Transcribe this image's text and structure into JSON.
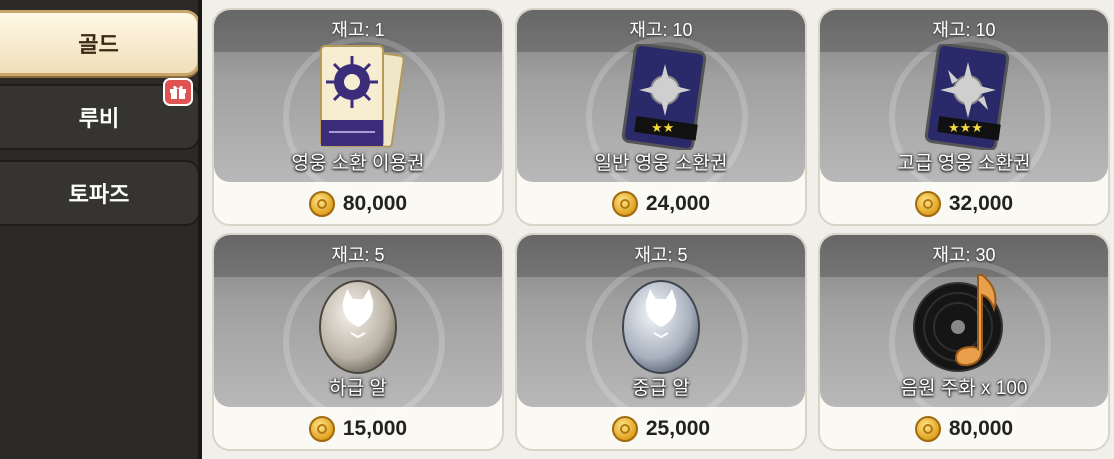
{
  "sidebar": {
    "tabs": [
      {
        "label": "골드"
      },
      {
        "label": "루비"
      },
      {
        "label": "토파즈"
      }
    ]
  },
  "shop": {
    "items": [
      {
        "stock": "재고: 1",
        "name": "영웅 소환 이용권",
        "price": "80,000",
        "icon": "hero-ticket-icon"
      },
      {
        "stock": "재고: 10",
        "name": "일반 영웅 소환권",
        "price": "24,000",
        "icon": "normal-summon-card-icon"
      },
      {
        "stock": "재고: 10",
        "name": "고급 영웅 소환권",
        "price": "32,000",
        "icon": "advanced-summon-card-icon"
      },
      {
        "stock": "재고: 5",
        "name": "하급 알",
        "price": "15,000",
        "icon": "low-egg-icon"
      },
      {
        "stock": "재고: 5",
        "name": "중급 알",
        "price": "25,000",
        "icon": "mid-egg-icon"
      },
      {
        "stock": "재고: 30",
        "name": "음원 주화 x 100",
        "price": "80,000",
        "icon": "music-coin-icon"
      }
    ]
  },
  "colors": {
    "accent_gold": "#c9a66b",
    "badge_red": "#e05353",
    "card_star": "#f5d83a"
  }
}
